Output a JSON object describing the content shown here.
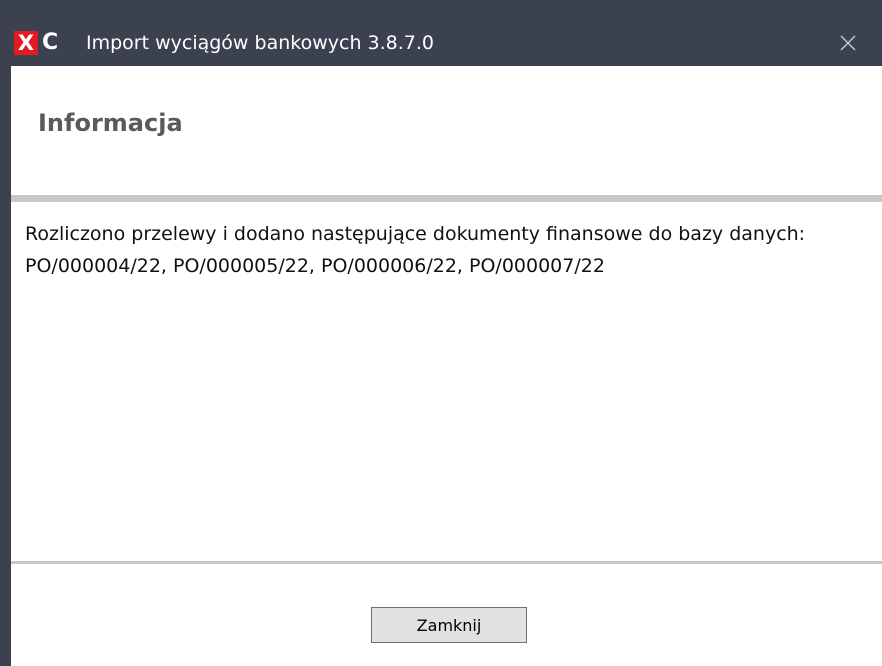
{
  "window": {
    "logo_x": "X",
    "logo_c": "C",
    "title": "Import wyciągów bankowych 3.8.7.0",
    "close_icon": "close-icon"
  },
  "dialog": {
    "heading": "Informacja",
    "message": "Rozliczono przelewy i dodano następujące dokumenty finansowe do bazy danych: PO/000004/22, PO/000005/22, PO/000006/22, PO/000007/22",
    "close_button_label": "Zamknij"
  },
  "colors": {
    "titlebar": "#3c4150",
    "logo_red": "#e11b22",
    "divider": "#c8c8c8",
    "heading_text": "#5a5a5a",
    "button_bg": "#e1e1e1"
  }
}
